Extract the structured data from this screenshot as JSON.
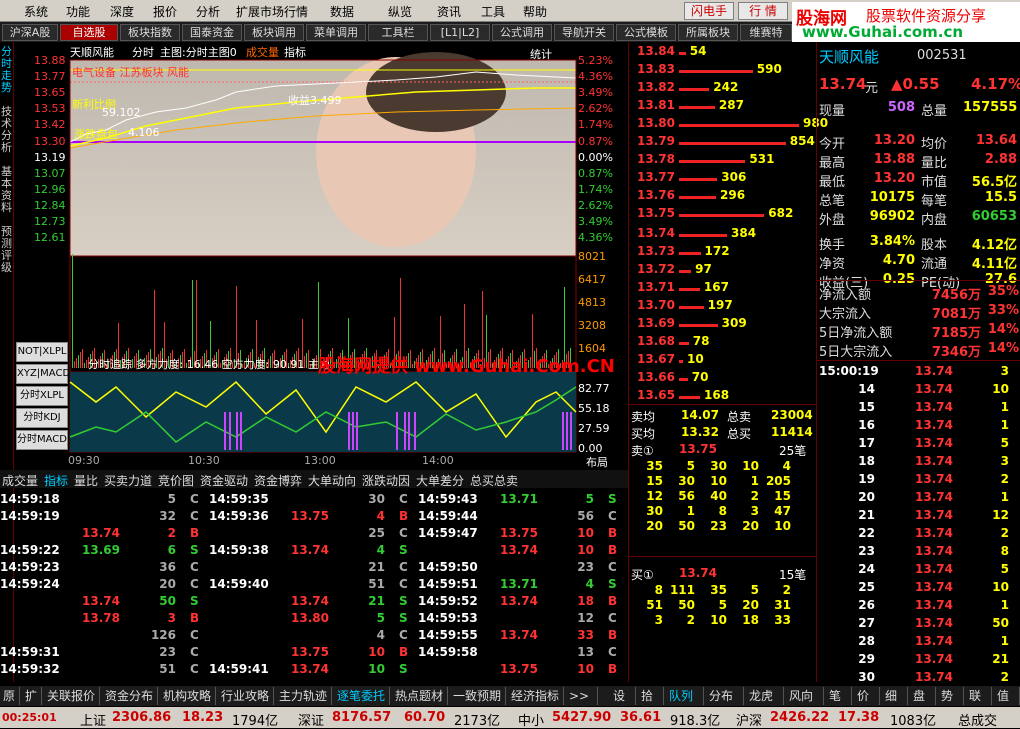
{
  "menu": {
    "items": [
      "系统",
      "功能",
      "深度",
      "报价",
      "分析",
      "扩展市场行情",
      "数据",
      "纵览",
      "资讯",
      "工具",
      "帮助"
    ],
    "flash": "闪电手",
    "quote": "行 情"
  },
  "banner": {
    "site": "股海网",
    "slogan": "股票软件资源分享",
    "url": "www.Guhai.com.cn"
  },
  "tabs": [
    "沪深A股",
    "自选股",
    "板块指数",
    "国泰资金",
    "板块调用",
    "菜单调用",
    "工具栏",
    "[L1|L2]",
    "公式调用",
    "导航开关",
    "公式模板",
    "所属板块",
    "维赛特"
  ],
  "lefttabs": [
    "分时走势",
    "技术分析",
    "基本资料",
    "预测评级"
  ],
  "chart": {
    "title_items": [
      "天顺风能",
      "分时",
      "主图:分时主图0",
      "成交量",
      "指标"
    ],
    "stats": "统计",
    "price_labels": [
      "13.88",
      "13.77",
      "13.65",
      "13.53",
      "13.42",
      "13.30",
      "13.19",
      "13.07",
      "12.96",
      "12.84",
      "12.73",
      "12.61"
    ],
    "pct_labels": [
      "5.23%",
      "4.36%",
      "3.49%",
      "2.62%",
      "1.74%",
      "0.87%",
      "0.00%",
      "0.87%",
      "1.74%",
      "2.62%",
      "3.49%",
      "4.36%"
    ],
    "vol_labels": [
      "8021",
      "6417",
      "4813",
      "3208",
      "1604"
    ],
    "annot": [
      "电气设备  江苏板块  风能",
      "新利比例",
      "59.102",
      "收益3.499",
      "涨跌盘包",
      "4.106"
    ],
    "ind_title": "分时追踪  多方力度: 16.46  空方力度: 90.91  主力",
    "ind_labels": [
      "82.77",
      "55.18",
      "27.59",
      "0.00"
    ],
    "watermark": "股海网提供 www.Guhai.Com.CN",
    "time_labels": [
      "09:30",
      "10:30",
      "13:00",
      "14:00"
    ],
    "layout": "布局",
    "side_btns": [
      "NOT|XLPL",
      "XYZ|MACD",
      "分时XLPL",
      "分时KDJ",
      "分时MACD"
    ]
  },
  "orderbook": {
    "sell": [
      [
        "13.84",
        "54"
      ],
      [
        "13.83",
        "590"
      ],
      [
        "13.82",
        "242"
      ],
      [
        "13.81",
        "287"
      ],
      [
        "13.80",
        "980"
      ],
      [
        "13.79",
        "854"
      ],
      [
        "13.78",
        "531"
      ],
      [
        "13.77",
        "306"
      ],
      [
        "13.76",
        "296"
      ],
      [
        "13.75",
        "682"
      ]
    ],
    "buy": [
      [
        "13.74",
        "384"
      ],
      [
        "13.73",
        "172"
      ],
      [
        "13.72",
        "97"
      ],
      [
        "13.71",
        "167"
      ],
      [
        "13.70",
        "197"
      ],
      [
        "13.69",
        "309"
      ],
      [
        "13.68",
        "78"
      ],
      [
        "13.67",
        "10"
      ],
      [
        "13.66",
        "70"
      ],
      [
        "13.65",
        "168"
      ]
    ],
    "sell_avg_label": "卖均",
    "sell_avg": "14.07",
    "sell_total_label": "总卖",
    "sell_total": "23004",
    "buy_avg_label": "买均",
    "buy_avg": "13.32",
    "buy_total_label": "总买",
    "buy_total": "11414",
    "ask1_label": "卖①",
    "ask1_price": "13.75",
    "ask1_count": "25笔",
    "ask1_q": [
      [
        "35",
        "5",
        "30",
        "10",
        "4"
      ],
      [
        "15",
        "30",
        "10",
        "1",
        "205"
      ],
      [
        "12",
        "56",
        "40",
        "2",
        "15"
      ],
      [
        "30",
        "1",
        "8",
        "3",
        "47"
      ],
      [
        "20",
        "50",
        "23",
        "20",
        "10"
      ]
    ],
    "bid1_label": "买①",
    "bid1_price": "13.74",
    "bid1_count": "15笔",
    "bid1_q": [
      [
        "8",
        "111",
        "35",
        "5",
        "2"
      ],
      [
        "51",
        "50",
        "5",
        "20",
        "31"
      ],
      [
        "3",
        "2",
        "10",
        "18",
        "33"
      ]
    ]
  },
  "info": {
    "name": "天顺风能",
    "code": "002531",
    "price": "13.74",
    "unit": "元",
    "change": "▲0.55",
    "pct": "4.17%",
    "rows": [
      [
        "现量",
        "508",
        "总量",
        "157555"
      ],
      [
        "今开",
        "13.20",
        "均价",
        "13.64"
      ],
      [
        "最高",
        "13.88",
        "量比",
        "2.88"
      ],
      [
        "最低",
        "13.20",
        "市值",
        "56.5亿"
      ],
      [
        "总笔",
        "10175",
        "每笔",
        "15.5"
      ],
      [
        "外盘",
        "96902",
        "内盘",
        "60653"
      ],
      [
        "换手",
        "3.84%",
        "股本",
        "4.12亿"
      ],
      [
        "净资",
        "4.70",
        "流通",
        "4.11亿"
      ],
      [
        "收益(三)",
        "0.25",
        "PE(动)",
        "27.6"
      ]
    ],
    "flows": [
      [
        "净流入额",
        "7456万",
        "35%"
      ],
      [
        "大宗流入",
        "7081万",
        "33%"
      ],
      [
        "5日净流入额",
        "7185万",
        "14%"
      ],
      [
        "5日大宗流入",
        "7346万",
        "14%"
      ]
    ],
    "ticks": [
      [
        "15:00:19",
        "13.74",
        "3"
      ],
      [
        "14",
        "13.74",
        "10"
      ],
      [
        "15",
        "13.74",
        "1"
      ],
      [
        "16",
        "13.74",
        "1"
      ],
      [
        "17",
        "13.74",
        "5"
      ],
      [
        "18",
        "13.74",
        "3"
      ],
      [
        "19",
        "13.74",
        "2"
      ],
      [
        "20",
        "13.74",
        "1"
      ],
      [
        "21",
        "13.74",
        "12"
      ],
      [
        "22",
        "13.74",
        "2"
      ],
      [
        "23",
        "13.74",
        "8"
      ],
      [
        "24",
        "13.74",
        "5"
      ],
      [
        "25",
        "13.74",
        "10"
      ],
      [
        "26",
        "13.74",
        "1"
      ],
      [
        "27",
        "13.74",
        "50"
      ],
      [
        "28",
        "13.74",
        "1"
      ],
      [
        "29",
        "13.74",
        "21"
      ],
      [
        "30",
        "13.74",
        "2"
      ]
    ]
  },
  "trade_tabs": [
    "成交量",
    "指标",
    "量比",
    "买卖力道",
    "竞价图",
    "资金驱动",
    "资金博弈",
    "大单动向",
    "涨跌动因",
    "大单差分",
    "总买总卖"
  ],
  "trades": [
    [
      [
        "14:59:18",
        "",
        "5",
        "C"
      ],
      [
        "14:59:19",
        "",
        "32",
        "C"
      ],
      [
        "",
        "13.74",
        "2",
        "B"
      ],
      [
        "14:59:22",
        "13.69",
        "6",
        "S"
      ],
      [
        "14:59:23",
        "",
        "36",
        "C"
      ],
      [
        "14:59:24",
        "",
        "20",
        "C"
      ],
      [
        "",
        "13.74",
        "50",
        "S"
      ],
      [
        "",
        "13.78",
        "3",
        "B"
      ],
      [
        "",
        "",
        "126",
        "C"
      ],
      [
        "14:59:31",
        "",
        "23",
        "C"
      ],
      [
        "14:59:32",
        "",
        "51",
        "C"
      ]
    ],
    [
      [
        "14:59:35",
        "",
        "30",
        "C"
      ],
      [
        "14:59:36",
        "13.75",
        "4",
        "B"
      ],
      [
        "",
        "",
        "25",
        "C"
      ],
      [
        "14:59:38",
        "13.74",
        "4",
        "S"
      ],
      [
        "",
        "",
        "21",
        "C"
      ],
      [
        "14:59:40",
        "",
        "51",
        "C"
      ],
      [
        "",
        "13.74",
        "21",
        "S"
      ],
      [
        "",
        "13.80",
        "5",
        "S"
      ],
      [
        "",
        "",
        "4",
        "C"
      ],
      [
        "",
        "13.75",
        "10",
        "B"
      ],
      [
        "14:59:41",
        "13.74",
        "10",
        "S"
      ]
    ],
    [
      [
        "14:59:43",
        "13.71",
        "5",
        "S"
      ],
      [
        "14:59:44",
        "",
        "56",
        "C"
      ],
      [
        "14:59:47",
        "13.75",
        "10",
        "B"
      ],
      [
        "",
        "13.74",
        "10",
        "B"
      ],
      [
        "14:59:50",
        "",
        "23",
        "C"
      ],
      [
        "14:59:51",
        "13.71",
        "4",
        "S"
      ],
      [
        "14:59:52",
        "13.74",
        "18",
        "B"
      ],
      [
        "14:59:53",
        "",
        "12",
        "C"
      ],
      [
        "14:59:55",
        "13.74",
        "33",
        "B"
      ],
      [
        "14:59:58",
        "",
        "13",
        "C"
      ],
      [
        "",
        "13.75",
        "10",
        "B"
      ]
    ]
  ],
  "bottom_tabs": [
    "原",
    "扩",
    "关联报价",
    "资金分布",
    "机构攻略",
    "行业攻略",
    "主力轨迹",
    "逐笔委托",
    "热点题材",
    "一致预期",
    "经济指标",
    ">>",
    "设",
    "拾",
    "队列",
    "分布",
    "龙虎",
    "风向",
    "笔",
    "价",
    "细",
    "盘",
    "势",
    "联",
    "值",
    "主"
  ],
  "status": {
    "time": "00:25:01",
    "sh_label": "上证",
    "sh": "2306.86",
    "sh_chg": "18.23",
    "sh_amt": "1794亿",
    "sz_label": "深证",
    "sz": "8176.57",
    "sz_chg": "60.70",
    "sz_amt": "2173亿",
    "zx_label": "中小",
    "zx": "5427.90",
    "zx_chg": "36.61",
    "zx_amt": "918.3亿",
    "hs_label": "沪深",
    "hs": "2426.22",
    "hs_chg": "17.38",
    "hs_amt": "1083亿",
    "extra": "总成交"
  }
}
